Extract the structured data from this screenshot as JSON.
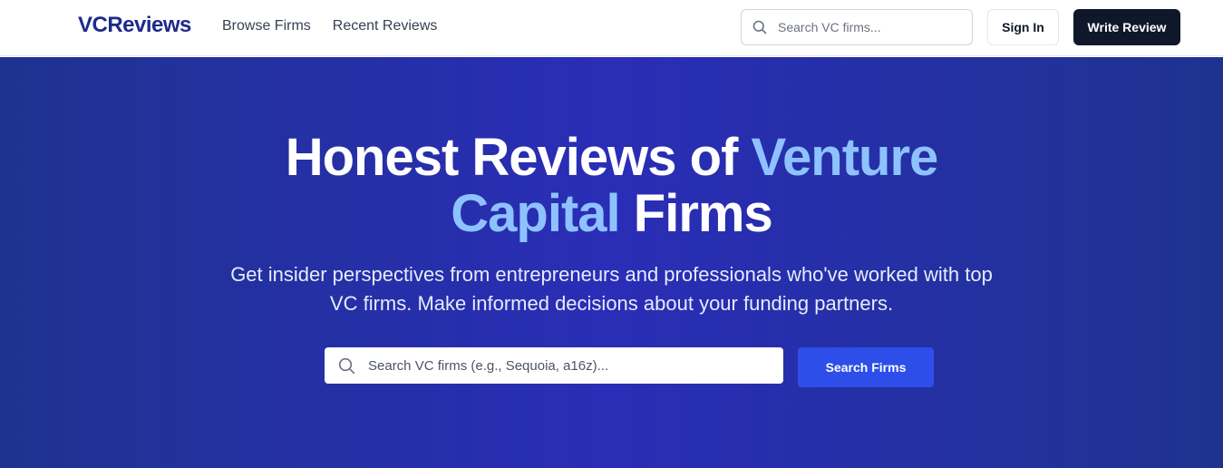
{
  "navbar": {
    "brand": "VCReviews",
    "links": [
      "Browse Firms",
      "Recent Reviews"
    ],
    "search_placeholder": "Search VC firms...",
    "signin_label": "Sign In",
    "write_review_label": "Write Review"
  },
  "hero": {
    "title_part1": "Honest Reviews of ",
    "title_accent1": "Venture",
    "title_accent2": "Capital",
    "title_part2": " Firms",
    "subtitle_line1": "Get insider perspectives from entrepreneurs and professionals who've worked with top",
    "subtitle_line2": "VC firms. Make informed decisions about your funding partners.",
    "search_placeholder": "Search VC firms (e.g., Sequoia, a16z)...",
    "search_button": "Search Firms"
  },
  "icons": {
    "nav_search": "search-icon",
    "hero_search": "search-icon"
  },
  "colors": {
    "brand": "#1e2a8a",
    "hero_bg": "#2a2db6",
    "accent_text": "#8ec2ff",
    "primary_button": "#2d4ee8",
    "dark_button": "#0f172a"
  }
}
